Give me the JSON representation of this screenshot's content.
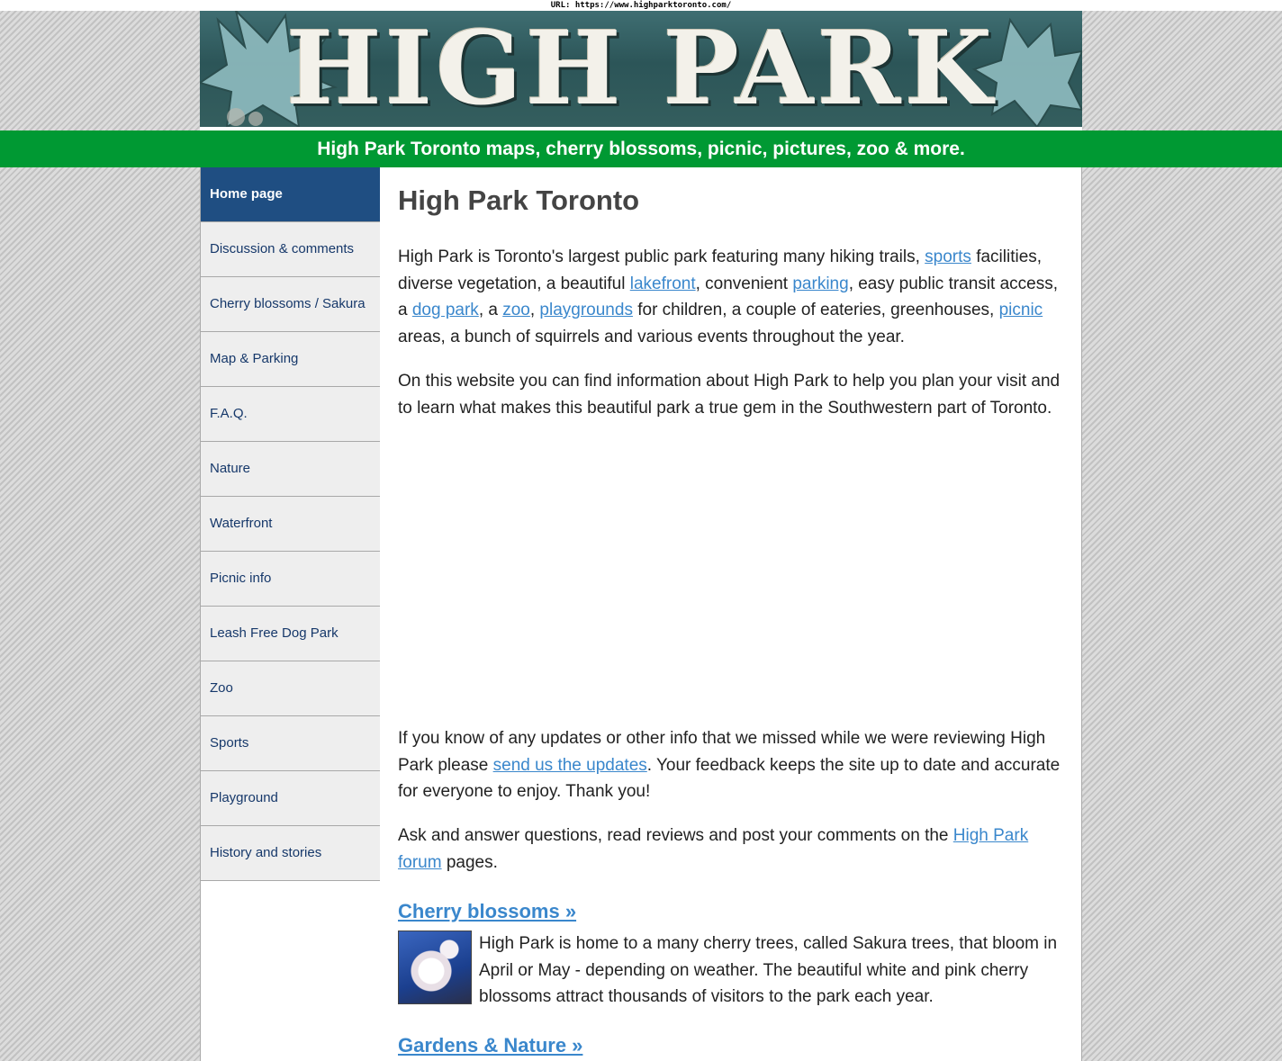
{
  "url_bar": {
    "text": "URL: https://www.highparktoronto.com/"
  },
  "banner": {
    "title": "HIGH PARK"
  },
  "tagline": "High Park Toronto maps, cherry blossoms, picnic, pictures, zoo & more.",
  "sidebar": {
    "items": [
      {
        "label": "Home page",
        "active": true
      },
      {
        "label": "Discussion & comments"
      },
      {
        "label": "Cherry blossoms / Sakura"
      },
      {
        "label": "Map & Parking"
      },
      {
        "label": "F.A.Q."
      },
      {
        "label": "Nature"
      },
      {
        "label": "Waterfront"
      },
      {
        "label": "Picnic info"
      },
      {
        "label": "Leash Free Dog Park"
      },
      {
        "label": "Zoo"
      },
      {
        "label": "Sports"
      },
      {
        "label": "Playground"
      },
      {
        "label": "History and stories"
      }
    ]
  },
  "main": {
    "heading": "High Park Toronto",
    "intro": {
      "t1": "High Park is Toronto's largest public park featuring many hiking trails, ",
      "link_sports": "sports",
      "t2": " facilities, diverse vegetation, a beautiful ",
      "link_lakefront": "lakefront",
      "t3": ", convenient ",
      "link_parking": "parking",
      "t4": ", easy public transit access, a ",
      "link_dogpark": "dog park",
      "t5": ", a ",
      "link_zoo": "zoo",
      "t6": ", ",
      "link_playgrounds": "playgrounds",
      "t7": " for children, a couple of eateries, greenhouses, ",
      "link_picnic": "picnic",
      "t8": " areas, a bunch of squirrels and various events throughout the year."
    },
    "website_para": "On this website you can find information about High Park to help you plan your visit and to learn what makes this beautiful park a true gem in the Southwestern part of Toronto.",
    "updates": {
      "t1": "If you know of any updates or other info that we missed while we were reviewing High Park please ",
      "link": "send us the updates",
      "t2": ". Your feedback keeps the site up to date and accurate for everyone to enjoy. Thank you!"
    },
    "forum": {
      "t1": "Ask and answer questions, read reviews and post your comments on the ",
      "link": "High Park forum",
      "t2": " pages."
    },
    "cherry": {
      "heading": "Cherry blossoms »",
      "text": "High Park is home to a many cherry trees, called Sakura trees, that bloom in April or May - depending on weather. The beautiful white and pink cherry blossoms attract thousands of visitors to the park each year."
    },
    "gardens": {
      "heading": "Gardens & Nature »"
    }
  }
}
